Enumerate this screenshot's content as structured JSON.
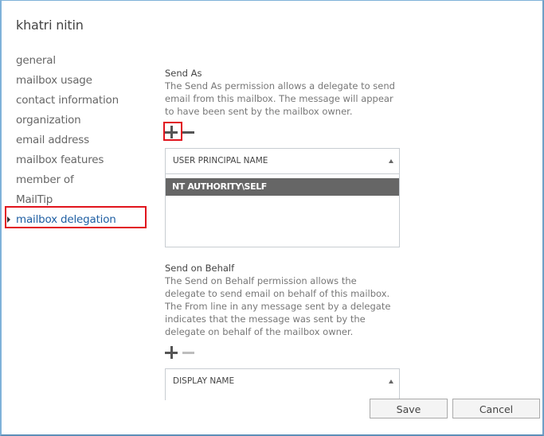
{
  "window": {
    "title": "khatri nitin"
  },
  "nav": {
    "items": [
      {
        "label": "general"
      },
      {
        "label": "mailbox usage"
      },
      {
        "label": "contact information"
      },
      {
        "label": "organization"
      },
      {
        "label": "email address"
      },
      {
        "label": "mailbox features"
      },
      {
        "label": "member of"
      },
      {
        "label": "MailTip"
      },
      {
        "label": "mailbox delegation",
        "active": true
      }
    ]
  },
  "send_as": {
    "title": "Send As",
    "description": "The Send As permission allows a delegate to send email from this mailbox. The message will appear to have been sent by the mailbox owner.",
    "add_icon": "plus-icon",
    "remove_icon": "minus-icon",
    "column_header": "USER PRINCIPAL NAME",
    "rows": [
      "NT AUTHORITY\\SELF"
    ]
  },
  "send_on_behalf": {
    "title": "Send on Behalf",
    "description": "The Send on Behalf permission allows the delegate to send email on behalf of this mailbox. The From line in any message sent by a delegate indicates that the message was sent by the delegate on behalf of the mailbox owner.",
    "add_icon": "plus-icon",
    "remove_icon": "minus-icon",
    "column_header": "DISPLAY NAME"
  },
  "footer": {
    "save_label": "Save",
    "cancel_label": "Cancel"
  },
  "colors": {
    "accent": "#1f5fa3",
    "highlight": "#e1141d",
    "selected_row": "#666666",
    "window_border": "#7fb2d9"
  }
}
